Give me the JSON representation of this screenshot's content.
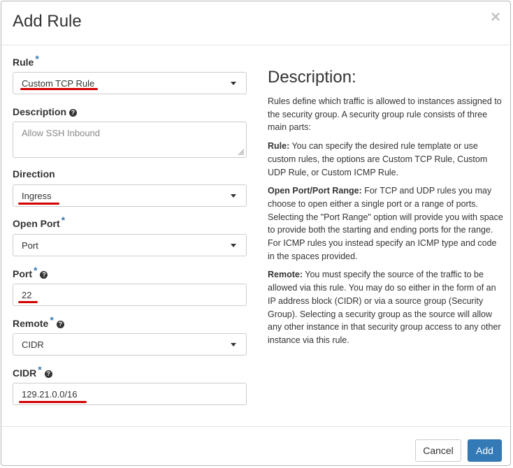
{
  "dialog": {
    "title": "Add Rule",
    "close_symbol": "×"
  },
  "form": {
    "rule": {
      "label": "Rule",
      "required": "*",
      "value": "Custom TCP Rule"
    },
    "description": {
      "label": "Description",
      "help": "?",
      "placeholder": "Allow SSH Inbound"
    },
    "direction": {
      "label": "Direction",
      "value": "Ingress"
    },
    "open_port": {
      "label": "Open Port",
      "required": "*",
      "value": "Port"
    },
    "port": {
      "label": "Port",
      "required": "*",
      "help": "?",
      "value": "22"
    },
    "remote": {
      "label": "Remote",
      "required": "*",
      "help": "?",
      "value": "CIDR"
    },
    "cidr": {
      "label": "CIDR",
      "required": "*",
      "help": "?",
      "value": "129.21.0.0/16"
    }
  },
  "help_panel": {
    "heading": "Description:",
    "intro": "Rules define which traffic is allowed to instances assigned to the security group. A security group rule consists of three main parts:",
    "rule_term": "Rule:",
    "rule_text": " You can specify the desired rule template or use custom rules, the options are Custom TCP Rule, Custom UDP Rule, or Custom ICMP Rule.",
    "port_term": "Open Port/Port Range:",
    "port_text": " For TCP and UDP rules you may choose to open either a single port or a range of ports. Selecting the \"Port Range\" option will provide you with space to provide both the starting and ending ports for the range. For ICMP rules you instead specify an ICMP type and code in the spaces provided.",
    "remote_term": "Remote:",
    "remote_text": " You must specify the source of the traffic to be allowed via this rule. You may do so either in the form of an IP address block (CIDR) or via a source group (Security Group). Selecting a security group as the source will allow any other instance in that security group access to any other instance via this rule."
  },
  "footer": {
    "cancel_label": "Cancel",
    "add_label": "Add"
  },
  "colors": {
    "primary": "#337ab7",
    "required": "#3a7ab8",
    "annotation": "#d30000"
  },
  "icons": [
    "close-icon",
    "help-icon",
    "chevron-down-icon",
    "resize-handle-icon"
  ]
}
